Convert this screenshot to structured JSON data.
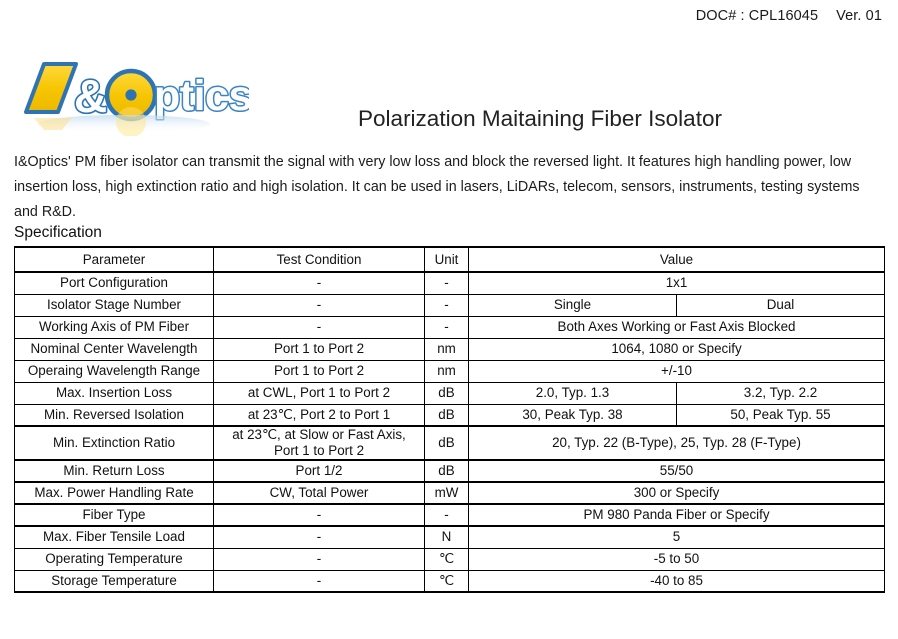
{
  "header": {
    "doc_label": "DOC# : CPL16045",
    "version": "Ver. 01"
  },
  "logo": {
    "text": "I&Optics",
    "letter_i": "I",
    "ampersand": "&",
    "word_rest": "ptics",
    "colors": {
      "yellow": "#F6C800",
      "blue": "#2E74B5",
      "outline": "#3A7FC1"
    }
  },
  "title": "Polarization Maitaining Fiber Isolator",
  "description": "I&Optics' PM fiber isolator can transmit the signal with very low loss and block the reversed light. It features high handling power, low insertion loss, high extinction ratio and high isolation. It can be used in lasers, LiDARs, telecom, sensors, instruments, testing systems and R&D.",
  "spec_section_label": "Specification",
  "table": {
    "columns": [
      "Parameter",
      "Test Condition",
      "Unit",
      "Value"
    ],
    "rows": [
      {
        "parameter": "Port Configuration",
        "condition": "-",
        "unit": "-",
        "value": "1x1",
        "value_span": 2
      },
      {
        "parameter": "Isolator Stage Number",
        "condition": "-",
        "unit": "-",
        "value_single": "Single",
        "value_dual": "Dual",
        "value_span": 1
      },
      {
        "parameter": "Working Axis of PM Fiber",
        "condition": "-",
        "unit": "-",
        "value": "Both Axes Working or Fast Axis Blocked",
        "value_span": 2
      },
      {
        "parameter": "Nominal Center Wavelength",
        "condition": "Port 1 to Port 2",
        "unit": "nm",
        "value": "1064, 1080 or Specify",
        "value_span": 2
      },
      {
        "parameter": "Operaing Wavelength Range",
        "condition": "Port 1 to Port 2",
        "unit": "nm",
        "value": "+/-10",
        "value_span": 2
      },
      {
        "parameter": "Max. Insertion Loss",
        "condition": "at CWL, Port 1 to Port 2",
        "unit": "dB",
        "value_single": "2.0, Typ. 1.3",
        "value_dual": "3.2, Typ. 2.2",
        "value_span": 1
      },
      {
        "parameter": "Min. Reversed Isolation",
        "condition": "at 23℃, Port 2 to Port 1",
        "unit": "dB",
        "value_single": "30, Peak Typ. 38",
        "value_dual": "50, Peak Typ. 55",
        "value_span": 1
      },
      {
        "parameter": "Min. Extinction Ratio",
        "condition_line1": "at 23℃, at Slow or Fast Axis,",
        "condition_line2": "Port 1 to Port 2",
        "unit": "dB",
        "value": "20, Typ. 22 (B-Type), 25, Typ. 28 (F-Type)",
        "value_span": 2
      },
      {
        "parameter": "Min. Return Loss",
        "condition": "Port 1/2",
        "unit": "dB",
        "value": "55/50",
        "value_span": 2
      },
      {
        "parameter": "Max. Power Handling Rate",
        "condition": "CW, Total Power",
        "unit": "mW",
        "value": "300 or Specify",
        "value_span": 2
      },
      {
        "parameter": "Fiber Type",
        "condition": "-",
        "unit": "-",
        "value": "PM 980 Panda Fiber or Specify",
        "value_span": 2
      },
      {
        "parameter": "Max. Fiber Tensile Load",
        "condition": "-",
        "unit": "N",
        "value": "5",
        "value_span": 2
      },
      {
        "parameter": "Operating Temperature",
        "condition": "-",
        "unit": "℃",
        "value": "-5 to 50",
        "value_span": 2
      },
      {
        "parameter": "Storage Temperature",
        "condition": "-",
        "unit": "℃",
        "value": "-40 to 85",
        "value_span": 2
      }
    ]
  }
}
